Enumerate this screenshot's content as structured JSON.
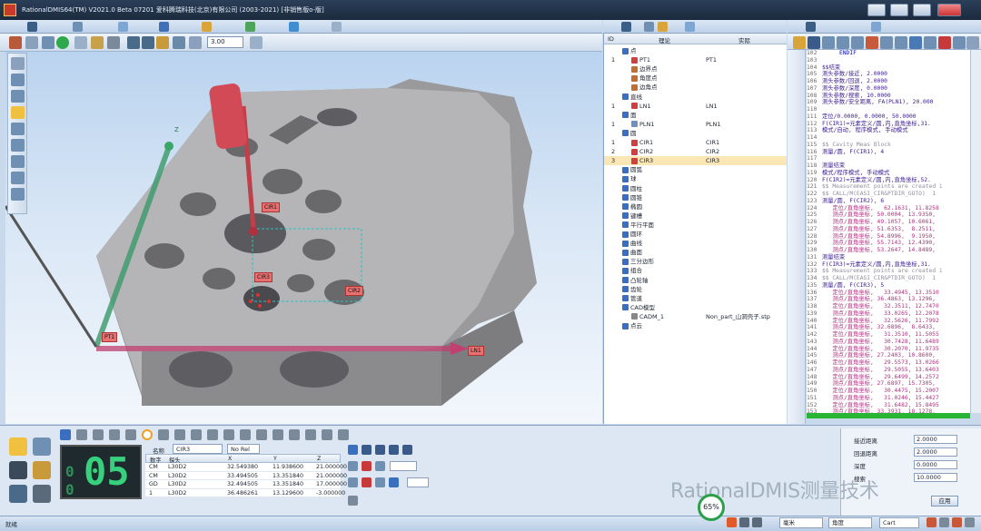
{
  "window": {
    "title": "RationalDMIS64(TM) V2021.0 Beta 07201   爱科腾瑞科技(北京)有限公司 (2003-2021) [非销售版o-版]"
  },
  "toolbar": {
    "zoom_value": "3.00"
  },
  "viewport": {
    "feature_labels": [
      "PT1",
      "LN1",
      "CIR1",
      "CIR3",
      "CIR2"
    ],
    "axis_label": "Z"
  },
  "tree": {
    "columns": {
      "id": "ID",
      "nominal": "理论",
      "actual": "实际"
    },
    "rows": [
      {
        "id": "",
        "name": "点",
        "actual": "",
        "indent": 0,
        "color": "#3a6fc0"
      },
      {
        "id": "1",
        "name": "PT1",
        "actual": "PT1",
        "indent": 1,
        "color": "#d04040"
      },
      {
        "id": "",
        "name": "边界点",
        "actual": "",
        "indent": 1,
        "color": "#c07030"
      },
      {
        "id": "",
        "name": "角度点",
        "actual": "",
        "indent": 1,
        "color": "#c07030"
      },
      {
        "id": "",
        "name": "边角点",
        "actual": "",
        "indent": 1,
        "color": "#c07030"
      },
      {
        "id": "",
        "name": "直线",
        "actual": "",
        "indent": 0,
        "color": "#3a6fc0"
      },
      {
        "id": "1",
        "name": "LN1",
        "actual": "LN1",
        "indent": 1,
        "color": "#d04040"
      },
      {
        "id": "",
        "name": "面",
        "actual": "",
        "indent": 0,
        "color": "#3a6fc0"
      },
      {
        "id": "1",
        "name": "PLN1",
        "actual": "PLN1",
        "indent": 1,
        "color": "#7090c0"
      },
      {
        "id": "",
        "name": "圆",
        "actual": "",
        "indent": 0,
        "color": "#3a6fc0"
      },
      {
        "id": "1",
        "name": "CIR1",
        "actual": "CIR1",
        "indent": 1,
        "color": "#d04040"
      },
      {
        "id": "2",
        "name": "CIR2",
        "actual": "CIR2",
        "indent": 1,
        "color": "#d04040"
      },
      {
        "id": "3",
        "name": "CIR3",
        "actual": "CIR3",
        "indent": 1,
        "color": "#d04040",
        "selected": true
      },
      {
        "id": "",
        "name": "圆弧",
        "actual": "",
        "indent": 0,
        "color": "#3a6fc0"
      },
      {
        "id": "",
        "name": "球",
        "actual": "",
        "indent": 0,
        "color": "#3a6fc0"
      },
      {
        "id": "",
        "name": "圆柱",
        "actual": "",
        "indent": 0,
        "color": "#3a6fc0"
      },
      {
        "id": "",
        "name": "圆锥",
        "actual": "",
        "indent": 0,
        "color": "#3a6fc0"
      },
      {
        "id": "",
        "name": "椭圆",
        "actual": "",
        "indent": 0,
        "color": "#3a6fc0"
      },
      {
        "id": "",
        "name": "键槽",
        "actual": "",
        "indent": 0,
        "color": "#3a6fc0"
      },
      {
        "id": "",
        "name": "平行平面",
        "actual": "",
        "indent": 0,
        "color": "#3a6fc0"
      },
      {
        "id": "",
        "name": "圆环",
        "actual": "",
        "indent": 0,
        "color": "#3a6fc0"
      },
      {
        "id": "",
        "name": "曲线",
        "actual": "",
        "indent": 0,
        "color": "#3a6fc0"
      },
      {
        "id": "",
        "name": "曲面",
        "actual": "",
        "indent": 0,
        "color": "#3a6fc0"
      },
      {
        "id": "",
        "name": "三分边形",
        "actual": "",
        "indent": 0,
        "color": "#3a6fc0"
      },
      {
        "id": "",
        "name": "组合",
        "actual": "",
        "indent": 0,
        "color": "#3a6fc0"
      },
      {
        "id": "",
        "name": "凸轮轴",
        "actual": "",
        "indent": 0,
        "color": "#3a6fc0"
      },
      {
        "id": "",
        "name": "齿轮",
        "actual": "",
        "indent": 0,
        "color": "#3a6fc0"
      },
      {
        "id": "",
        "name": "管道",
        "actual": "",
        "indent": 0,
        "color": "#3a6fc0"
      },
      {
        "id": "",
        "name": "CAD模型",
        "actual": "",
        "indent": 0,
        "color": "#3a6fc0"
      },
      {
        "id": "",
        "name": "CADM_1",
        "actual": "Non_part_山洞壳子.stp",
        "indent": 1,
        "color": "#888"
      },
      {
        "id": "",
        "name": "点云",
        "actual": "",
        "indent": 0,
        "color": "#3a6fc0"
      }
    ]
  },
  "code": {
    "lines": [
      {
        "n": "102",
        "t": "     ENDIF",
        "c": "bl"
      },
      {
        "n": "103",
        "t": "",
        "c": "bl"
      },
      {
        "n": "104",
        "t": "$$结束",
        "c": "pu"
      },
      {
        "n": "105",
        "t": "测头参数/接近, 2.0000",
        "c": "pu"
      },
      {
        "n": "106",
        "t": "测头参数/回退, 2.0000",
        "c": "pu"
      },
      {
        "n": "107",
        "t": "测头参数/深度, 0.0000",
        "c": "pu"
      },
      {
        "n": "108",
        "t": "测头参数/搜索, 10.0000",
        "c": "pu"
      },
      {
        "n": "109",
        "t": "测头参数/安全距离, FA(PLN1), 20.000",
        "c": "pu"
      },
      {
        "n": "110",
        "t": "",
        "c": "pu"
      },
      {
        "n": "111",
        "t": "定位/0.0000, 0.0000, 50.0000",
        "c": "pu"
      },
      {
        "n": "112",
        "t": "F(CIR1)=元素定义/圆,内,直角坐标,31.",
        "c": "pu"
      },
      {
        "n": "113",
        "t": "模式/自动, 程序模式, 手动模式",
        "c": "pu"
      },
      {
        "n": "114",
        "t": "",
        "c": "pu"
      },
      {
        "n": "115",
        "t": "$$ Cavity Meas Block",
        "c": "gy"
      },
      {
        "n": "116",
        "t": "测量/圆, F(CIR1), 4",
        "c": "pu"
      },
      {
        "n": "117",
        "t": "",
        "c": "pu"
      },
      {
        "n": "118",
        "t": "测量结束",
        "c": "pu"
      },
      {
        "n": "119",
        "t": "模式/程序模式, 手动模式",
        "c": "pu"
      },
      {
        "n": "120",
        "t": "F(CIR2)=元素定义/圆,内,直角坐标,52.",
        "c": "pu"
      },
      {
        "n": "121",
        "t": "$$ Measurement points are created i",
        "c": "gy"
      },
      {
        "n": "122",
        "t": "$$ CALL/M(EASI_CIR&PTDIR_GOTO)  1",
        "c": "gy"
      },
      {
        "n": "123",
        "t": "测量/圆, F(CIR2), 6",
        "c": "pu"
      },
      {
        "n": "124",
        "t": "   定位/直角坐标,   62.1631, 11.8258",
        "c": "pk"
      },
      {
        "n": "125",
        "t": "   测点/直角坐标, 50.0004, 13.9350,",
        "c": "pk"
      },
      {
        "n": "126",
        "t": "   测点/直角坐标, 49.1057, 10.6061,",
        "c": "pk"
      },
      {
        "n": "127",
        "t": "   测点/直角坐标, 51.6353,  8.2511,",
        "c": "pk"
      },
      {
        "n": "128",
        "t": "   测点/直角坐标, 54.8996,  9.1950,",
        "c": "pk"
      },
      {
        "n": "129",
        "t": "   测点/直角坐标, 55.7143, 12.4390,",
        "c": "pk"
      },
      {
        "n": "130",
        "t": "   测点/直角坐标, 53.2647, 14.8489,",
        "c": "pk"
      },
      {
        "n": "131",
        "t": "测量结束",
        "c": "pu"
      },
      {
        "n": "132",
        "t": "F(CIR3)=元素定义/圆,内,直角坐标,31.",
        "c": "pu"
      },
      {
        "n": "133",
        "t": "$$ Measurement points are created i",
        "c": "gy"
      },
      {
        "n": "134",
        "t": "$$ CALL/M(EASI_CIR&PTDIR_GOTO)  1",
        "c": "gy"
      },
      {
        "n": "135",
        "t": "测量/圆, F(CIR3), 5",
        "c": "pu"
      },
      {
        "n": "136",
        "t": "   定位/直角坐标,   33.4945, 13.3510",
        "c": "pk"
      },
      {
        "n": "137",
        "t": "   测点/直角坐标, 36.4863, 13.1296,",
        "c": "pk"
      },
      {
        "n": "138",
        "t": "   定位/直角坐标,   32.3511, 12.7470",
        "c": "pk"
      },
      {
        "n": "139",
        "t": "   测点/直角坐标,   33.0265, 12.2078",
        "c": "pk"
      },
      {
        "n": "140",
        "t": "   定位/直角坐标,   32.5626, 11.7992",
        "c": "pk"
      },
      {
        "n": "141",
        "t": "   测点/直角坐标, 32.6896,  8.6433,",
        "c": "pk"
      },
      {
        "n": "142",
        "t": "   定位/直角坐标,   31.3510, 11.5055",
        "c": "pk"
      },
      {
        "n": "143",
        "t": "   测点/直角坐标,   30.7428, 11.6489",
        "c": "pk"
      },
      {
        "n": "144",
        "t": "   定位/直角坐标,   30.2070, 11.9735",
        "c": "pk"
      },
      {
        "n": "145",
        "t": "   测点/直角坐标, 27.2403, 10.8600,",
        "c": "pk"
      },
      {
        "n": "146",
        "t": "   定位/直角坐标,   29.5573, 13.0266",
        "c": "pk"
      },
      {
        "n": "147",
        "t": "   测点/直角坐标,   29.5055, 13.6403",
        "c": "pk"
      },
      {
        "n": "148",
        "t": "   定位/直角坐标,   29.6499, 14.2572",
        "c": "pk"
      },
      {
        "n": "149",
        "t": "   测点/直角坐标, 27.6897, 15.7305,",
        "c": "pk"
      },
      {
        "n": "150",
        "t": "   定位/直角坐标,   30.4475, 15.2007",
        "c": "pk"
      },
      {
        "n": "151",
        "t": "   测点/直角坐标,   31.0246, 15.4427",
        "c": "pk"
      },
      {
        "n": "152",
        "t": "   定位/直角坐标,   31.6482, 15.8495",
        "c": "pk"
      },
      {
        "n": "153",
        "t": "   测点/直角坐标, 33.3931, 18.1278,",
        "c": "pk"
      },
      {
        "n": "154",
        "t": "   定位/直角坐标,   32.2572, 15.3511",
        "c": "pk"
      },
      {
        "n": "155",
        "t": "测量结束",
        "c": "pu"
      },
      {
        "n": "156",
        "t": "",
        "c": "hi"
      }
    ]
  },
  "bottom": {
    "counter_lead": "0",
    "counter_lead2": "0",
    "counter_value": "05",
    "name_label": "名称",
    "name_value": "CIR3",
    "ref_value": "No Rel",
    "table_headers": [
      "数字",
      "探头",
      "X",
      "Y",
      "Z"
    ],
    "table_rows": [
      [
        "CM",
        "L30D2",
        "32.549380",
        "11.938600",
        "21.000000"
      ],
      [
        "CM",
        "L30D2",
        "33.494505",
        "13.351840",
        "21.000000"
      ],
      [
        "GD",
        "L30D2",
        "32.494505",
        "13.351840",
        "17.000000"
      ],
      [
        "1",
        "L30D2",
        "36.486261",
        "13.129600",
        "-3.000000"
      ]
    ]
  },
  "right_panel": {
    "labels": [
      "接近距离",
      "回退距离",
      "深度",
      "搜索"
    ],
    "values": [
      "2.0000",
      "2.0000",
      "0.0000",
      "10.0000"
    ],
    "apply_label": "应用"
  },
  "status": {
    "left_text": "就绪",
    "percent": "65%",
    "unit_select": "毫米",
    "angle_select": "角度",
    "coord_select": "Cart"
  },
  "watermark": "RationalDMIS测量技术"
}
